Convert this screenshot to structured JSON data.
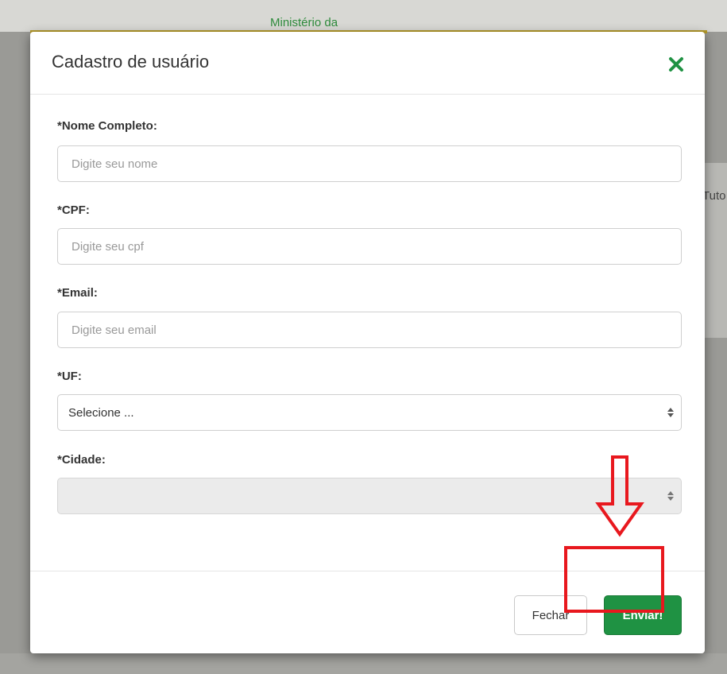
{
  "background": {
    "top_text": "Ministério da",
    "side_text": "Tuto"
  },
  "modal": {
    "title": "Cadastro de usuário",
    "close_icon": "close-x-icon",
    "accent_color": "#1f9243",
    "fields": {
      "nome": {
        "label": "*Nome Completo:",
        "placeholder": "Digite seu nome",
        "value": ""
      },
      "cpf": {
        "label": "*CPF:",
        "placeholder": "Digite seu cpf",
        "value": ""
      },
      "email": {
        "label": "*Email:",
        "placeholder": "Digite seu email",
        "value": ""
      },
      "uf": {
        "label": "*UF:",
        "selected": "Selecione ..."
      },
      "cidade": {
        "label": "*Cidade:",
        "selected": "",
        "disabled": true
      }
    },
    "footer": {
      "close_label": "Fechar",
      "submit_label": "Enviar!"
    }
  },
  "annotation": {
    "color": "#e8181e",
    "arrow_icon": "down-arrow-icon",
    "target": "submit-button"
  }
}
